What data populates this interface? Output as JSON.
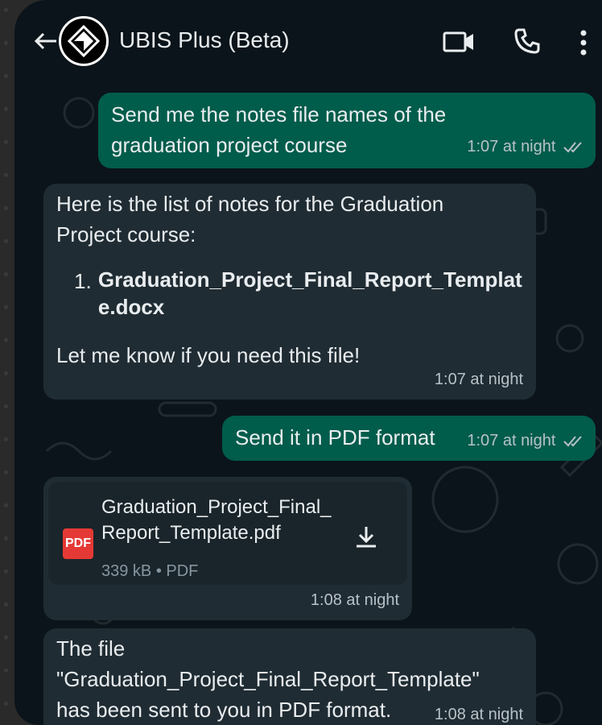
{
  "header": {
    "title": "UBIS Plus (Beta)"
  },
  "messages": [
    {
      "dir": "out",
      "text": "Send me the notes file names of the graduation project course",
      "time": "1:07 at night"
    },
    {
      "dir": "in",
      "intro": "Here is the list of notes for the Graduation Project course:",
      "list_num": "1.",
      "list_item": "Graduation_Project_Final_Report_Template.docx",
      "outro": "Let me know if you need this file!",
      "time": "1:07 at night"
    },
    {
      "dir": "out",
      "text": "Send it in PDF format",
      "time": "1:07 at night"
    },
    {
      "dir": "in",
      "doc_badge": "PDF",
      "doc_name": "Graduation_Project_Final_Report_Template.pdf",
      "doc_meta": "339 kB • PDF",
      "time": "1:08 at night"
    },
    {
      "dir": "in",
      "text": "The file \"Graduation_Project_Final_Report_Template\" has been sent to you in PDF format.",
      "time": "1:08 at night"
    }
  ],
  "colors": {
    "background": "#0b141a",
    "outgoing_bubble": "#005c4b",
    "incoming_bubble": "#202c33",
    "pdf_badge": "#e53935"
  },
  "icons": [
    "back-arrow-icon",
    "app-logo-icon",
    "video-call-icon",
    "phone-call-icon",
    "more-options-icon",
    "read-ticks-icon",
    "pdf-file-icon",
    "download-icon"
  ]
}
